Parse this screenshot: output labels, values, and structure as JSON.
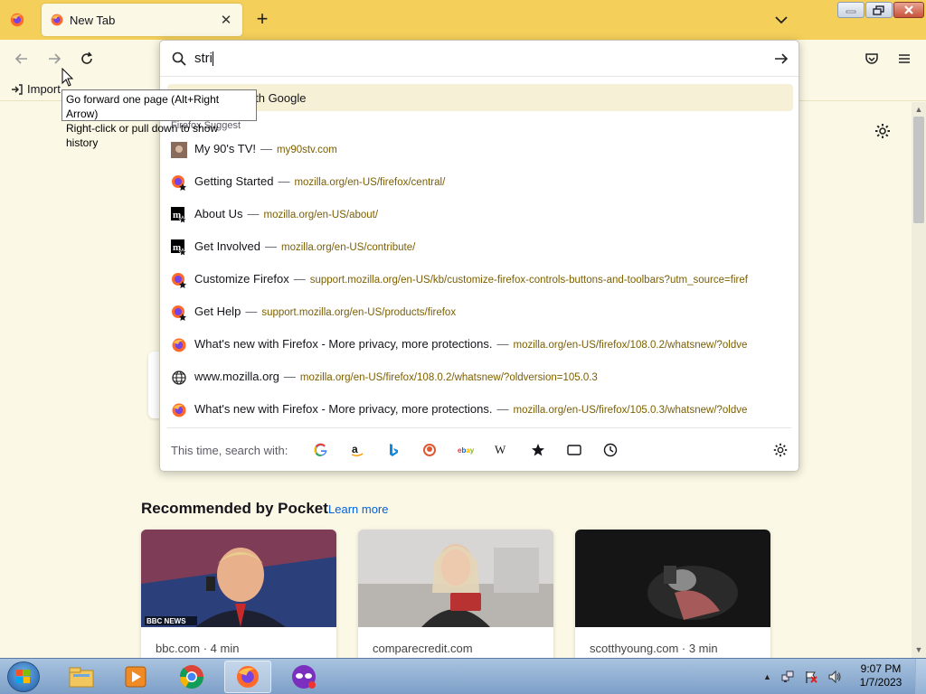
{
  "tab": {
    "title": "New Tab",
    "close_icon": "close-icon"
  },
  "navbar": {
    "back": "back-icon",
    "forward": "forward-icon",
    "reload": "reload-icon",
    "pocket": "pocket-icon",
    "menu": "hamburger-menu-icon"
  },
  "bookmarks": {
    "import_label": "Import"
  },
  "urlbar": {
    "typed_text": "stri",
    "highlight_suffix": "h with Google",
    "section_label": "Firefox Suggest",
    "rows": [
      {
        "title": "My 90's TV!",
        "url": "my90stv.com",
        "icon": "site-thumbnail-icon"
      },
      {
        "title": "Getting Started",
        "url": "mozilla.org/en-US/firefox/central/",
        "icon": "firefox-bookmark-icon"
      },
      {
        "title": "About Us",
        "url": "mozilla.org/en-US/about/",
        "icon": "mozilla-bookmark-icon"
      },
      {
        "title": "Get Involved",
        "url": "mozilla.org/en-US/contribute/",
        "icon": "mozilla-bookmark-icon"
      },
      {
        "title": "Customize Firefox",
        "url": "support.mozilla.org/en-US/kb/customize-firefox-controls-buttons-and-toolbars?utm_source=firef",
        "icon": "firefox-bookmark-icon"
      },
      {
        "title": "Get Help",
        "url": "support.mozilla.org/en-US/products/firefox",
        "icon": "firefox-bookmark-icon"
      },
      {
        "title": "What's new with Firefox - More privacy, more protections.",
        "url": "mozilla.org/en-US/firefox/108.0.2/whatsnew/?oldve",
        "icon": "firefox-icon"
      },
      {
        "title": "www.mozilla.org",
        "url": "mozilla.org/en-US/firefox/108.0.2/whatsnew/?oldversion=105.0.3",
        "icon": "globe-icon"
      },
      {
        "title": "What's new with Firefox - More privacy, more protections.",
        "url": "mozilla.org/en-US/firefox/105.0.3/whatsnew/?oldve",
        "icon": "firefox-icon"
      }
    ],
    "footer_label": "This time, search with:",
    "engines": [
      "google-icon",
      "amazon-icon",
      "bing-icon",
      "duckduckgo-icon",
      "ebay-icon",
      "wikipedia-icon",
      "bookmarks-star-icon",
      "tabs-icon",
      "history-icon"
    ]
  },
  "tooltip": {
    "line1": "Go forward one page (Alt+Right Arrow)",
    "line2": "Right-click or pull down to show history"
  },
  "pocket": {
    "title": "Recommended by Pocket",
    "learn_more": "Learn more",
    "cards": [
      {
        "source": "bbc.com · 4 min",
        "badge": "BBC NEWS"
      },
      {
        "source": "comparecredit.com"
      },
      {
        "source": "scotthyoung.com · 3 min"
      }
    ]
  },
  "taskbar": {
    "apps": [
      "explorer-icon",
      "media-player-icon",
      "chrome-icon",
      "firefox-icon",
      "app-mask-icon"
    ],
    "time": "9:07 PM",
    "date": "1/7/2023"
  },
  "colors": {
    "accent": "#f4cf5a",
    "page_bg": "#fbf8e5",
    "url_text": "#7c5f00",
    "link": "#0061e0"
  }
}
